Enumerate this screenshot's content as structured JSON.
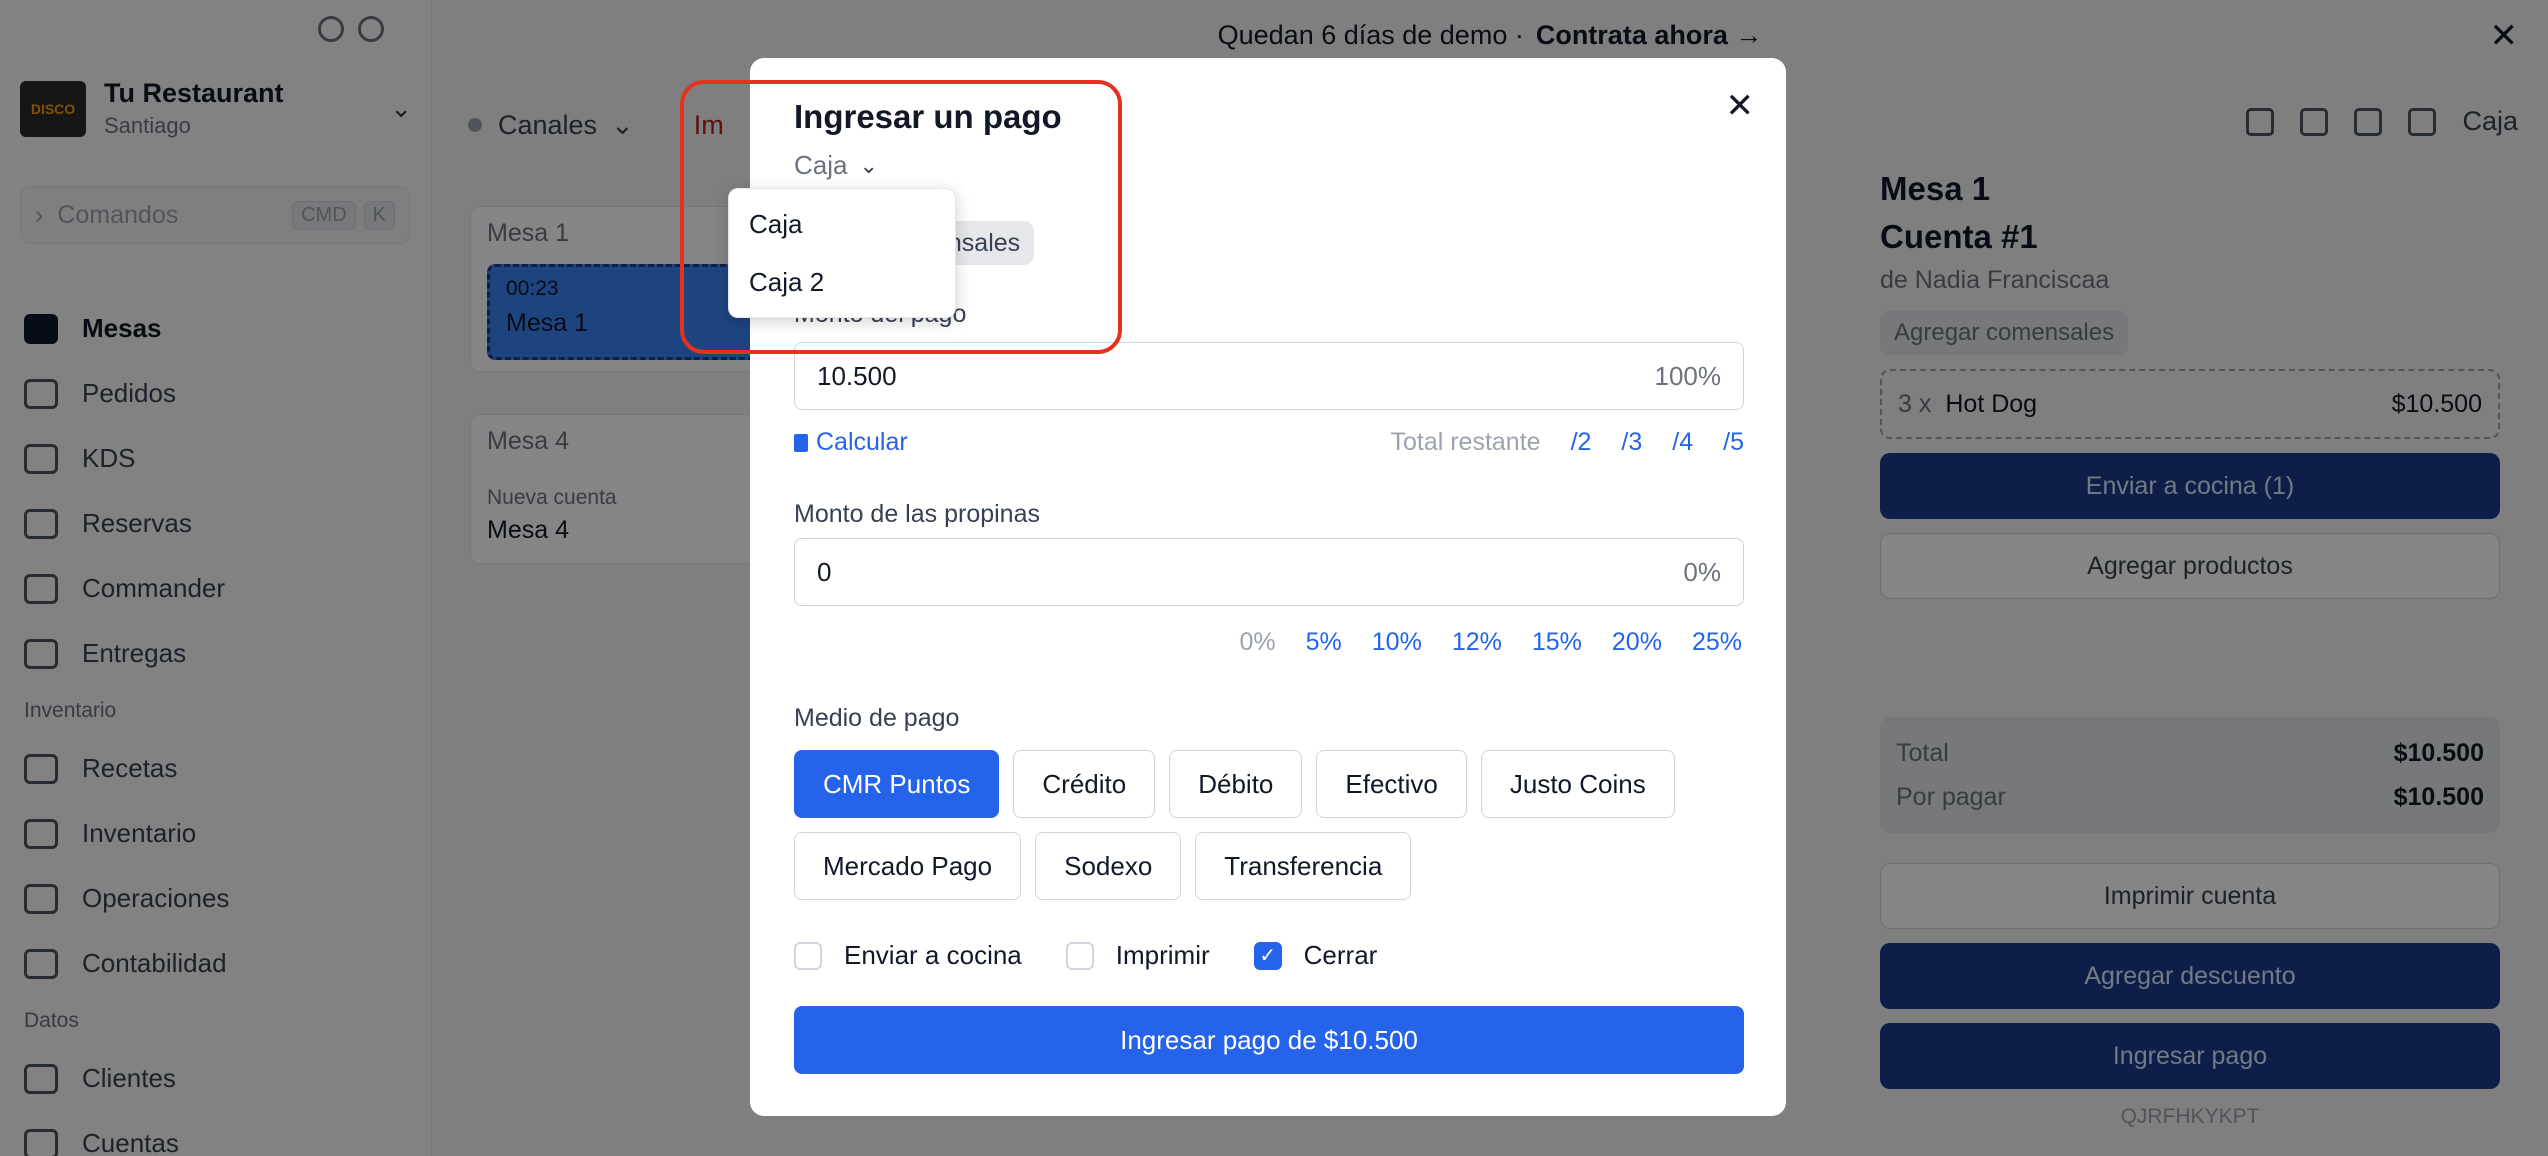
{
  "sidebar": {
    "restaurant_name": "Tu Restaurant",
    "restaurant_city": "Santiago",
    "command_placeholder": "Comandos",
    "kbd1": "CMD",
    "kbd2": "K",
    "nav": [
      "Mesas",
      "Pedidos",
      "KDS",
      "Reservas",
      "Commander",
      "Entregas"
    ],
    "section_inventario": "Inventario",
    "nav_inv": [
      "Recetas",
      "Inventario",
      "Operaciones",
      "Contabilidad"
    ],
    "section_datos": "Datos",
    "nav_datos": [
      "Clientes",
      "Cuentas"
    ]
  },
  "banner": {
    "text": "Quedan 6 días de demo ·",
    "cta": "Contrata ahora →"
  },
  "main": {
    "channels": "Canales",
    "warn": "Im",
    "table1_name": "Mesa 1",
    "table1_time": "00:23",
    "table1_label": "Mesa 1",
    "table4_name": "Mesa 4",
    "table4_status": "Nueva cuenta",
    "table4_label": "Mesa 4",
    "caja_label": "Caja"
  },
  "panel": {
    "title": "Mesa 1",
    "account": "Cuenta #1",
    "author": "de Nadia Franciscaa",
    "add_diners": "Agregar comensales",
    "line_qty": "3 x",
    "line_item": "Hot Dog",
    "line_price": "$10.500",
    "send_kitchen": "Enviar a cocina (1)",
    "add_products": "Agregar productos",
    "total_label": "Total",
    "total_value": "$10.500",
    "due_label": "Por pagar",
    "due_value": "$10.500",
    "print": "Imprimir cuenta",
    "discount": "Agregar descuento",
    "pay": "Ingresar pago",
    "code": "QJRFHKYKPT"
  },
  "modal": {
    "title": "Ingresar un pago",
    "caja_selected": "Caja",
    "comensales_pill": "ensales",
    "amount_label": "Monto del pago",
    "amount_value": "10.500",
    "amount_pct": "100%",
    "calc": "Calcular",
    "remaining": "Total restante",
    "splits": [
      "/2",
      "/3",
      "/4",
      "/5"
    ],
    "tips_label": "Monto de las propinas",
    "tips_value": "0",
    "tips_pct": "0%",
    "tip_options": [
      "0%",
      "5%",
      "10%",
      "12%",
      "15%",
      "20%",
      "25%"
    ],
    "method_label": "Medio de pago",
    "methods": [
      "CMR Puntos",
      "Crédito",
      "Débito",
      "Efectivo",
      "Justo Coins",
      "Mercado Pago",
      "Sodexo",
      "Transferencia"
    ],
    "check_kitchen": "Enviar a cocina",
    "check_print": "Imprimir",
    "check_close": "Cerrar",
    "submit": "Ingresar pago de $10.500"
  },
  "dropdown": {
    "options": [
      "Caja",
      "Caja 2"
    ]
  },
  "colors": {
    "primary": "#2563eb",
    "highlight": "#e5321f"
  }
}
